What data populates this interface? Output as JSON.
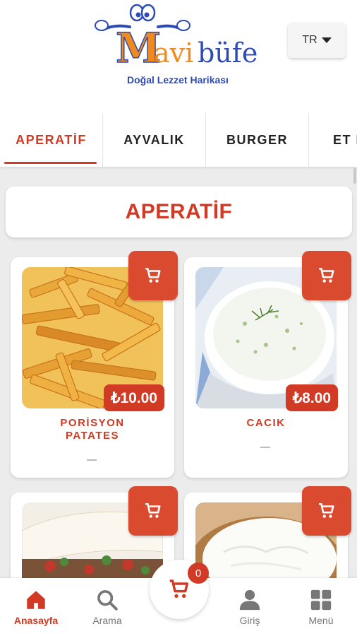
{
  "brand": {
    "name": "Mavi büfe",
    "tagline": "Doğal Lezzet Harikası"
  },
  "language": {
    "selected": "TR"
  },
  "tabs": [
    {
      "label": "APERATİF",
      "active": true
    },
    {
      "label": "AYVALIK",
      "active": false
    },
    {
      "label": "BURGER",
      "active": false
    },
    {
      "label": "ET DÖNER",
      "active": false
    }
  ],
  "section": {
    "title": "APERATİF"
  },
  "products": [
    {
      "name": "PORİSYON PATATES",
      "price": "₺10.00",
      "image": "french-fries"
    },
    {
      "name": "CACIK",
      "price": "₺8.00",
      "image": "cacik-bowl"
    },
    {
      "name": "",
      "price": "",
      "image": "doner-wrap"
    },
    {
      "name": "",
      "price": "",
      "image": "yogurt-bowl"
    }
  ],
  "cart": {
    "count": "0"
  },
  "bottom_nav": {
    "home": "Anasayfa",
    "search": "Arama",
    "login": "Giriş",
    "menu": "Menü"
  },
  "colors": {
    "accent": "#d13a24",
    "logo_blue": "#2d4bb5",
    "logo_orange": "#f08a1c"
  }
}
